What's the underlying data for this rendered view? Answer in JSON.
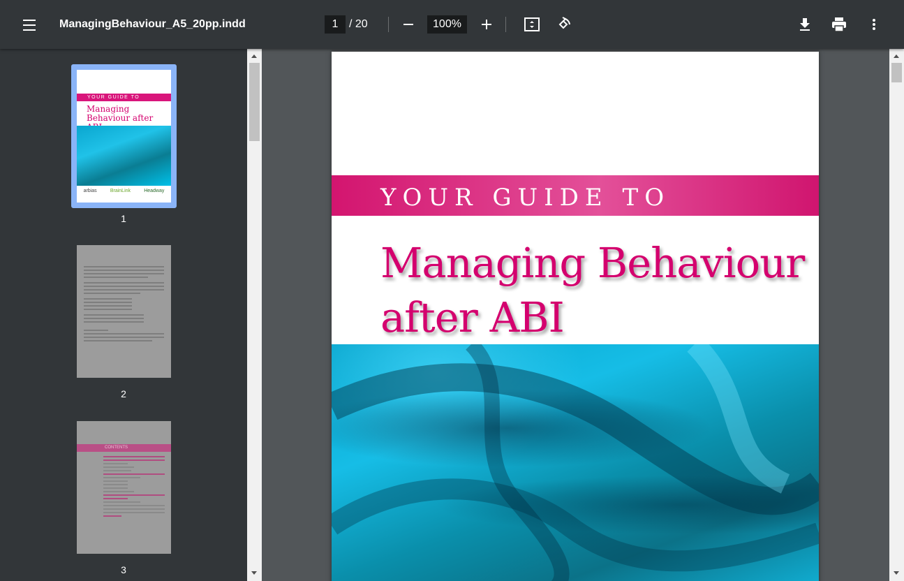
{
  "toolbar": {
    "title": "ManagingBehaviour_A5_20pp.indd",
    "current_page": "1",
    "total_pages": "/ 20",
    "zoom": "100%",
    "icons": [
      "menu-icon",
      "zoom-out-icon",
      "zoom-in-icon",
      "fit-page-icon",
      "rotate-icon",
      "download-icon",
      "print-icon",
      "more-vert-icon"
    ]
  },
  "sidebar": {
    "thumbnails": [
      {
        "label": "1",
        "band": "YOUR GUIDE TO",
        "title": "Managing Behaviour after ABI",
        "logos": [
          "arbias",
          "BrainLink",
          "Headway"
        ]
      },
      {
        "label": "2"
      },
      {
        "label": "3",
        "band": "CONTENTS"
      }
    ]
  },
  "page": {
    "guide_text": "YOUR GUIDE TO",
    "title_line1": "Managing Behaviour",
    "title_line2": "after ABI"
  },
  "colors": {
    "toolbar": "#323639",
    "viewer_bg": "#525659",
    "brand_pink": "#d4006e",
    "cyan": "#16bde6",
    "selection": "#8ab4f8"
  }
}
